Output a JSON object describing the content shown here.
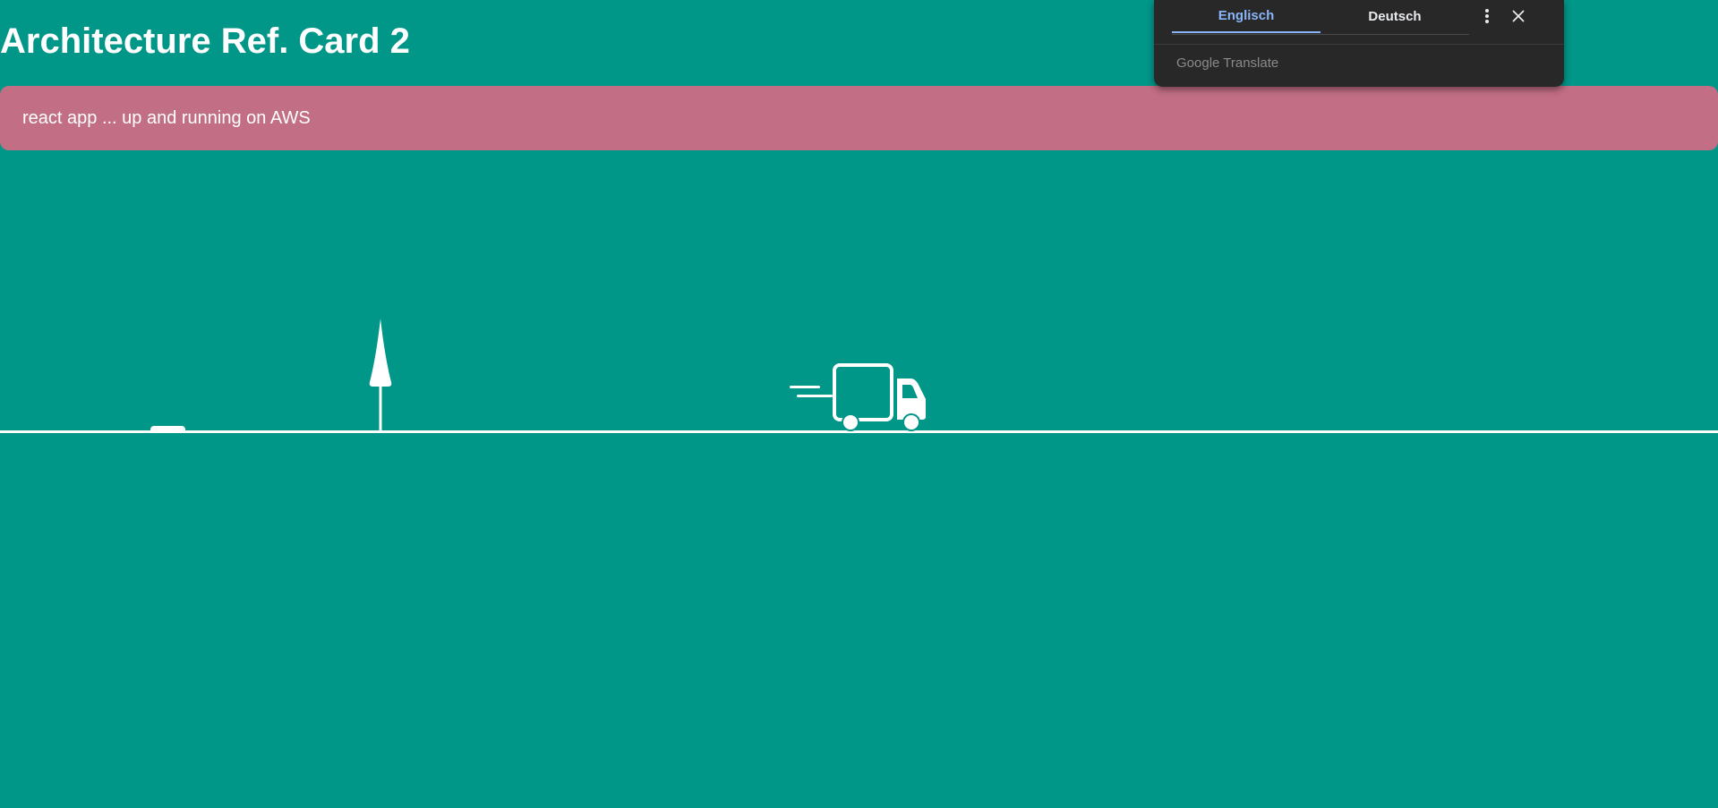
{
  "page": {
    "title": "Architecture Ref. Card 2",
    "status_message": "react app ... up and running on AWS"
  },
  "translate_popup": {
    "source_language": "Englisch",
    "target_language": "Deutsch",
    "powered_by": "Google Translate",
    "more_icon": "more-vert-icon",
    "close_icon": "close-icon"
  },
  "colors": {
    "background": "#009688",
    "banner": "#c26e84",
    "popup_background": "#282828",
    "active_tab": "#8ab4f8"
  }
}
